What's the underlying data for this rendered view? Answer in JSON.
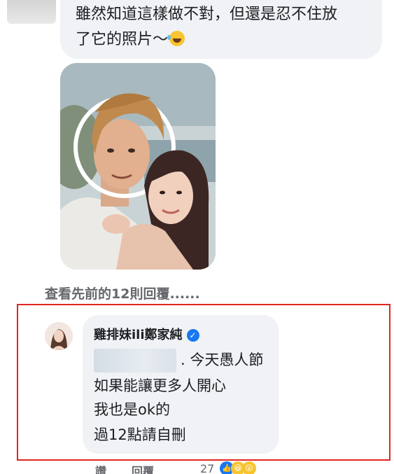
{
  "top_comment": {
    "line1": "雖然知道這樣做不對，但還是忍不住放",
    "line2": "了它的照片～",
    "emoji": "laughing-tears-emoji"
  },
  "more_replies": "查看先前的12則回覆......",
  "reply": {
    "author": "雞排妹ili鄭家純",
    "verified": "✓",
    "line1": ". 今天愚人節",
    "line2": "如果能讓更多人開心",
    "line3": "我也是ok的",
    "line4": "過12點請自刪"
  },
  "actions": {
    "like": "讚",
    "reply": "回覆",
    "reaction_count": "27"
  },
  "colors": {
    "bubble": "#f0f2f5",
    "highlight_border": "#e0261f",
    "verified": "#1877f2",
    "secondary_text": "#65676b"
  }
}
